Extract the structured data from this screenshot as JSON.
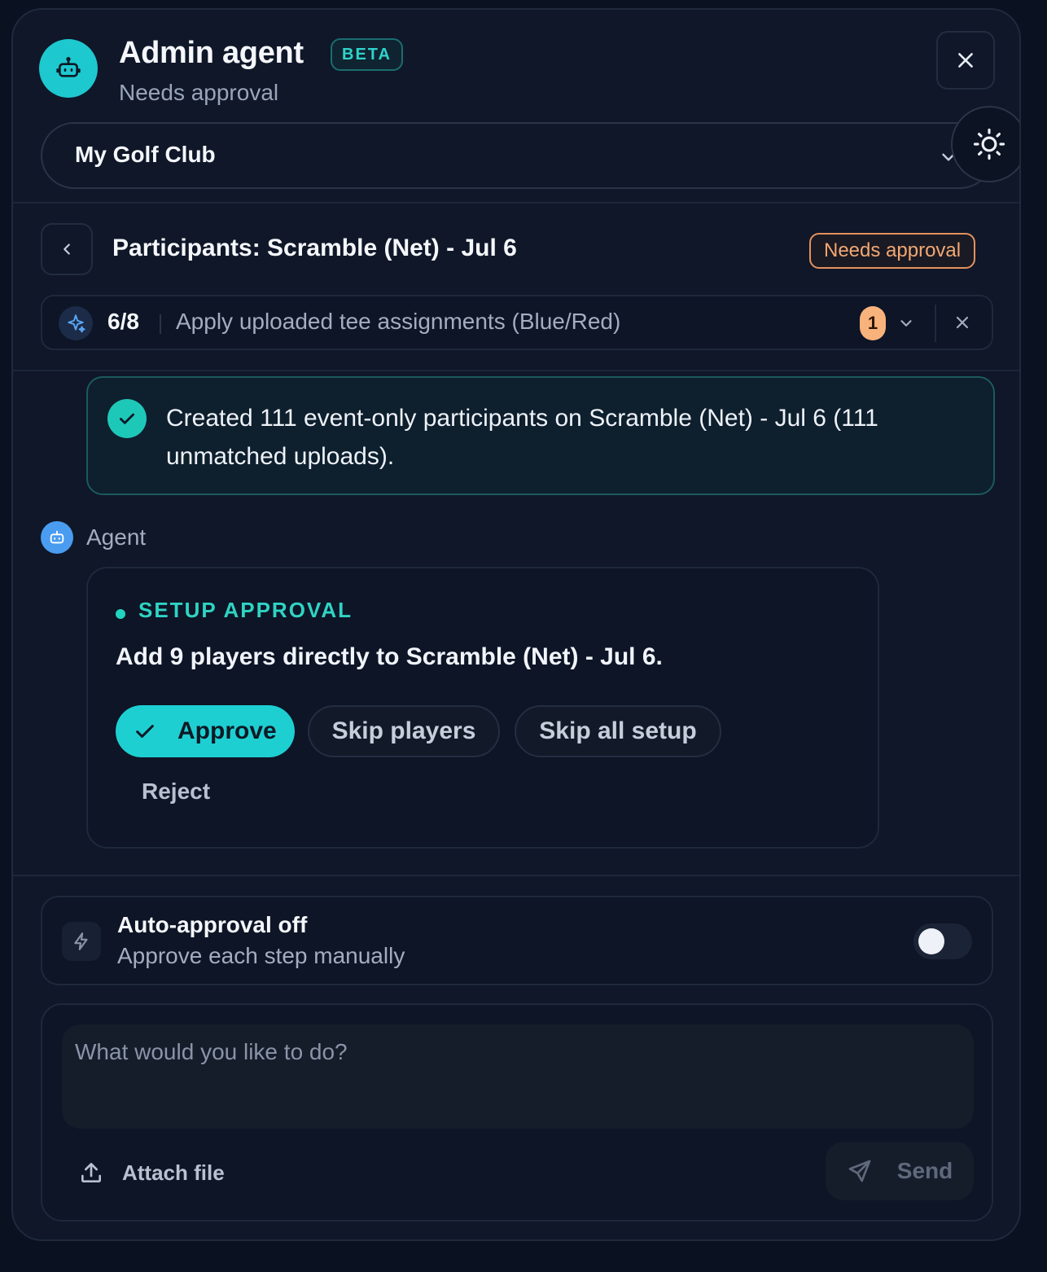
{
  "header": {
    "title": "Admin agent",
    "badge": "BETA",
    "subtitle": "Needs approval",
    "close_icon": "close-icon",
    "theme_icon": "sun-icon"
  },
  "club_select": {
    "value": "My Golf Club"
  },
  "task": {
    "title": "Participants: Scramble (Net) - Jul 6",
    "status": "Needs approval",
    "step_progress": "6/8",
    "step_description": "Apply uploaded tee assignments (Blue/Red)",
    "step_count_badge": "1"
  },
  "success_message": "Created 111 event-only participants on Scramble (Net) - Jul 6 (111 unmatched uploads).",
  "agent": {
    "label": "Agent"
  },
  "approval": {
    "label": "SETUP APPROVAL",
    "text": "Add 9 players directly to Scramble (Net) - Jul 6.",
    "approve_label": "Approve",
    "skip_players_label": "Skip players",
    "skip_all_label": "Skip all setup",
    "reject_label": "Reject"
  },
  "auto_approval": {
    "title": "Auto-approval off",
    "subtitle": "Approve each step manually",
    "enabled": false
  },
  "composer": {
    "placeholder": "What would you like to do?",
    "attach_label": "Attach file",
    "send_label": "Send"
  },
  "colors": {
    "accent": "#1ec8cf",
    "warning": "#f2a872",
    "success": "#1ec8b8"
  }
}
